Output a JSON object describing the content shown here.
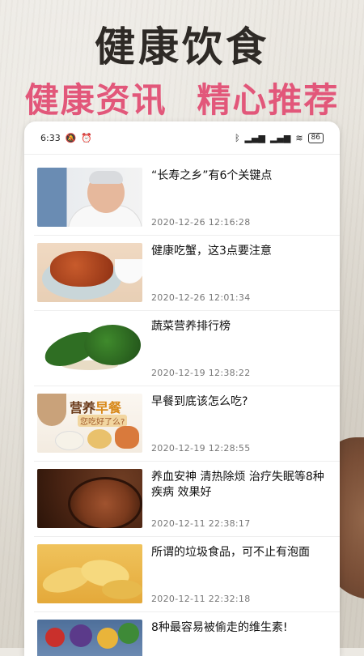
{
  "header": {
    "title": "健康饮食",
    "subtitle_left": "健康资讯",
    "subtitle_right": "精心推荐"
  },
  "statusbar": {
    "time": "6:33",
    "battery": "86"
  },
  "news": [
    {
      "title": "“长寿之乡”有6个关键点",
      "date": "2020-12-26 12:16:28"
    },
    {
      "title": "健康吃蟹，这3点要注意",
      "date": "2020-12-26 12:01:34"
    },
    {
      "title": "蔬菜营养排行榜",
      "date": "2020-12-19 12:38:22"
    },
    {
      "title": "早餐到底该怎么吃?",
      "date": "2020-12-19 12:28:55",
      "thumb_label_a": "营养",
      "thumb_label_b": "早餐",
      "thumb_sub": "您吃好了么?"
    },
    {
      "title": " 养血安神 清热除烦 治疗失眠等8种疾病 效果好",
      "date": "2020-12-11 22:38:17"
    },
    {
      "title": "所谓的垃圾食品，可不止有泡面",
      "date": "2020-12-11 22:32:18"
    },
    {
      "title": "8种最容易被偷走的维生素!",
      "date": ""
    }
  ],
  "colors": {
    "subtitle": "#e2577a",
    "title": "#2e2a26"
  }
}
